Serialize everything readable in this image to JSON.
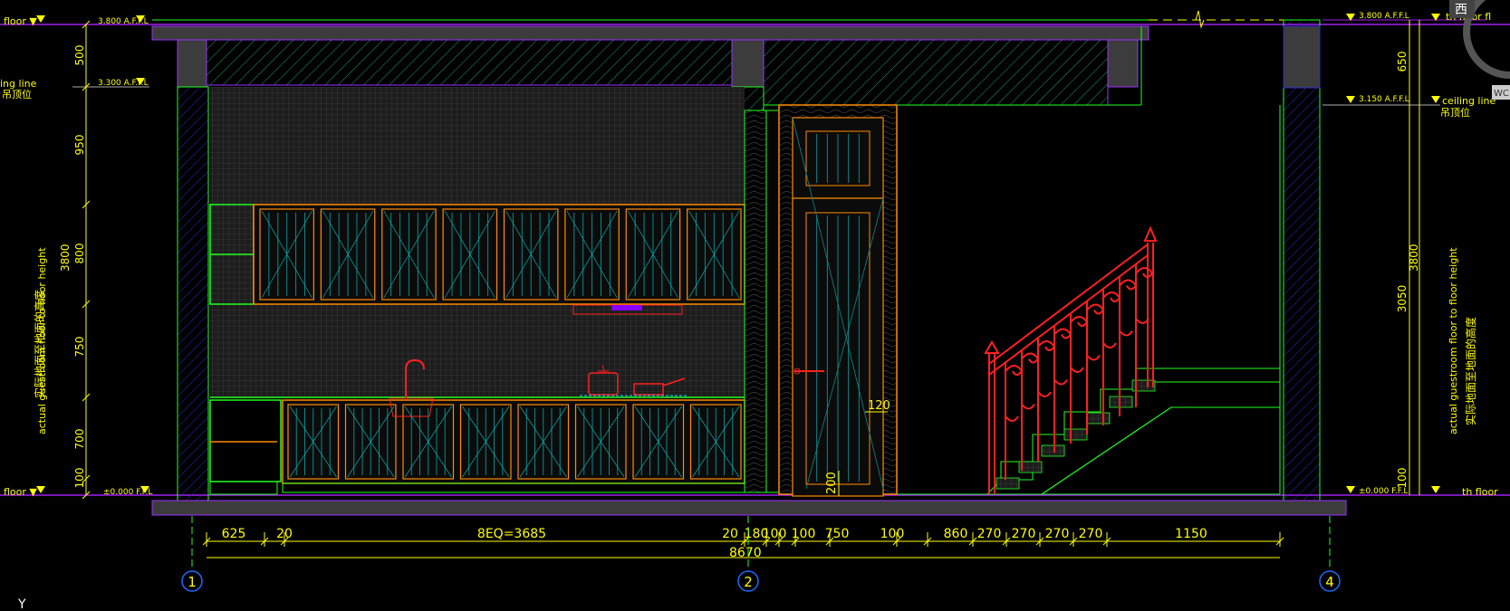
{
  "left_labels": {
    "floor_top": "floor ▼",
    "ceiling_en": "ing line",
    "ceiling_cn": "吊顶位",
    "floor_bottom": "floor ▼",
    "vertical_cn": "实际地面至地面的高度",
    "vertical_en": "actual guestroom floor to floor height",
    "total_height": "3800"
  },
  "left_levels": {
    "top": "3.800 A.F.F.L",
    "ceiling": "3.300 A.F.F.L",
    "bottom": "±0.000 F.F.L"
  },
  "left_dims": [
    "500",
    "950",
    "800",
    "750",
    "700",
    "100"
  ],
  "right_levels": {
    "top": "3.800 A.F.F.L",
    "ceiling": "3.150 A.F.F.L",
    "bottom": "±0.000 F.F.L"
  },
  "right_labels": {
    "floor_top": "th floor fl",
    "ceiling_en": "ceiling line",
    "ceiling_cn": "吊顶位",
    "floor_bottom": "th floor",
    "vertical_cn": "实际地面至地面的高度",
    "vertical_en": "actual guestroom floor to floor height",
    "total_height": "3800"
  },
  "right_dims": [
    "650",
    "3050",
    "100"
  ],
  "inner_dims": {
    "handle_gap": "120",
    "door_base": "200"
  },
  "bottom_dims": [
    "625",
    "20",
    "8EQ=3685",
    "20",
    "180",
    "100",
    "100",
    "750",
    "100",
    "860",
    "270",
    "270",
    "270",
    "270",
    "1150"
  ],
  "total_width": "8670",
  "grid_markers": [
    "1",
    "2",
    "4"
  ],
  "corner_cn": "西",
  "corner_tag": "WC",
  "ucs_label": "Y"
}
